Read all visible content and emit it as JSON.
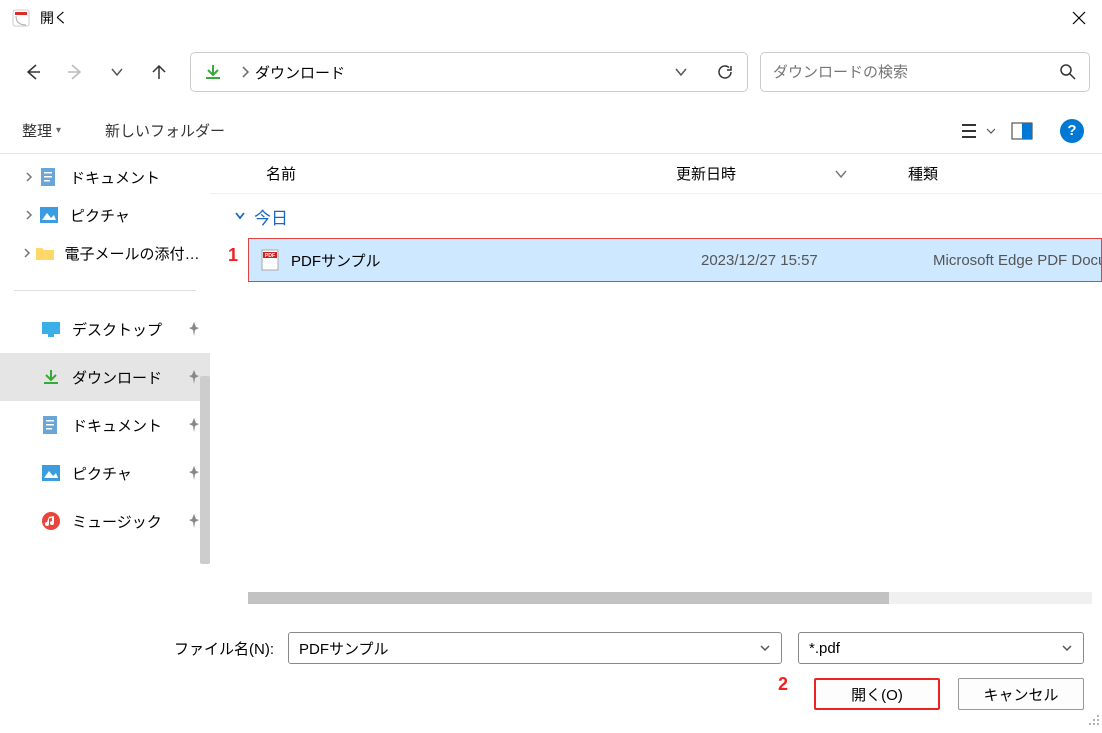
{
  "window": {
    "title": "開く"
  },
  "nav": {
    "breadcrumb": "ダウンロード",
    "search_placeholder": "ダウンロードの検索"
  },
  "commands": {
    "organize": "整理",
    "new_folder": "新しいフォルダー"
  },
  "tree": {
    "items": [
      {
        "label": "ドキュメント"
      },
      {
        "label": "ピクチャ"
      },
      {
        "label": "電子メールの添付ファイル"
      }
    ]
  },
  "quick": {
    "items": [
      {
        "label": "デスクトップ",
        "icon": "desktop",
        "color": "#3bb0e8"
      },
      {
        "label": "ダウンロード",
        "icon": "download",
        "color": "#38a838",
        "selected": true
      },
      {
        "label": "ドキュメント",
        "icon": "document",
        "color": "#6aa5d8"
      },
      {
        "label": "ピクチャ",
        "icon": "pictures",
        "color": "#3b9ce0"
      },
      {
        "label": "ミュージック",
        "icon": "music",
        "color": "#e8463c"
      }
    ]
  },
  "columns": {
    "name": "名前",
    "date": "更新日時",
    "type": "種類"
  },
  "groups": [
    {
      "label": "今日"
    }
  ],
  "files": [
    {
      "name": "PDFサンプル",
      "date": "2023/12/27 15:57",
      "type": "Microsoft Edge PDF Document",
      "selected": true
    }
  ],
  "annotations": {
    "marker1": "1",
    "marker2": "2"
  },
  "footer": {
    "file_name_label": "ファイル名(N):",
    "file_name_value": "PDFサンプル",
    "filter": "*.pdf",
    "open": "開く(O)",
    "cancel": "キャンセル"
  }
}
